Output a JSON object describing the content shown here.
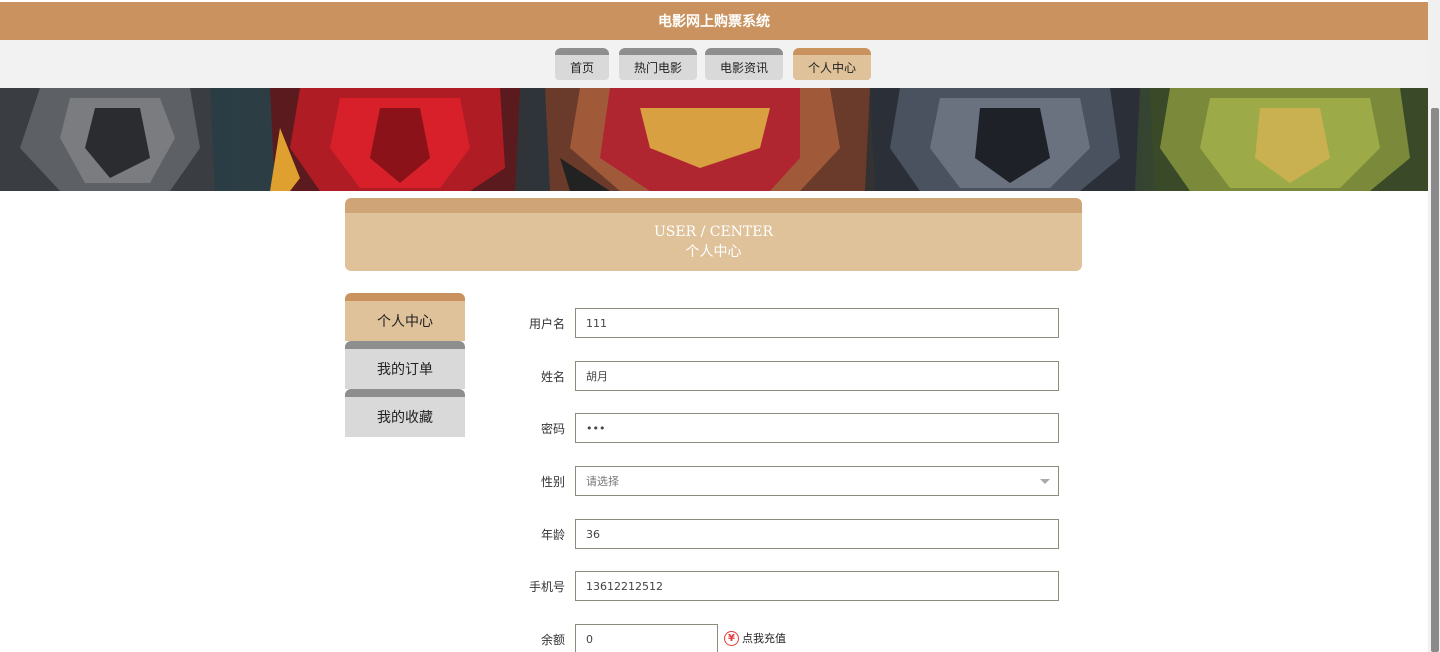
{
  "header": {
    "title": "电影网上购票系统"
  },
  "nav": {
    "tabs": [
      {
        "label": "首页",
        "active": false
      },
      {
        "label": "热门电影",
        "active": false
      },
      {
        "label": "电影资讯",
        "active": false
      },
      {
        "label": "个人中心",
        "active": true
      }
    ]
  },
  "section": {
    "title_en": "USER / CENTER",
    "title_cn": "个人中心"
  },
  "sidebar": {
    "items": [
      {
        "label": "个人中心",
        "active": true
      },
      {
        "label": "我的订单",
        "active": false
      },
      {
        "label": "我的收藏",
        "active": false
      }
    ]
  },
  "form": {
    "username": {
      "label": "用户名",
      "value": "111"
    },
    "name": {
      "label": "姓名",
      "value": "胡月"
    },
    "password": {
      "label": "密码",
      "value": "•••"
    },
    "gender": {
      "label": "性别",
      "placeholder": "请选择"
    },
    "age": {
      "label": "年龄",
      "value": "36"
    },
    "phone": {
      "label": "手机号",
      "value": "13612212512"
    },
    "balance": {
      "label": "余额",
      "value": "0",
      "recharge_label": "点我充值",
      "recharge_icon": "¥"
    }
  },
  "colors": {
    "brand": "#c9925e",
    "accent_light": "#dfc29a",
    "tab_gray": "#d9d9d9"
  }
}
